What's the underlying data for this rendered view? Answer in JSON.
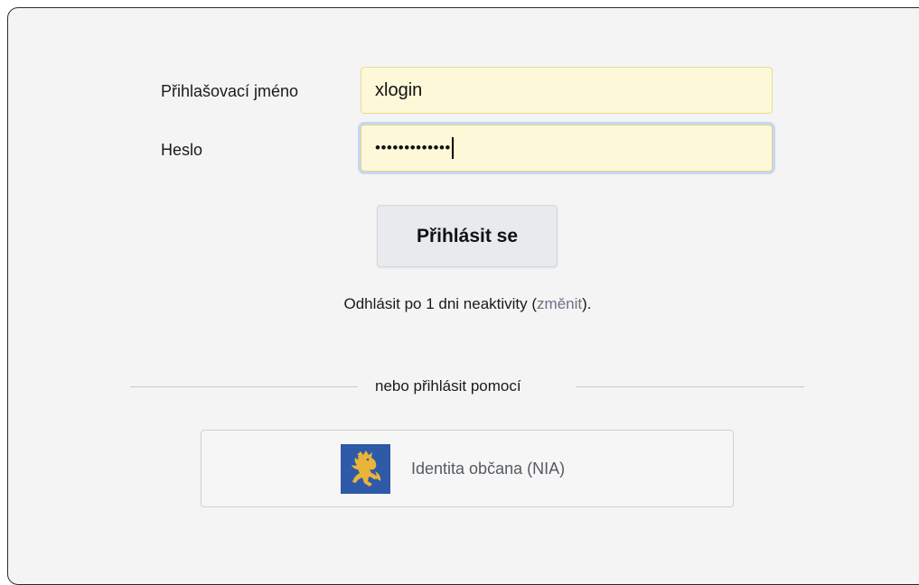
{
  "login_form": {
    "username_label": "Přihlašovací jméno",
    "username_value": "xlogin",
    "password_label": "Heslo",
    "password_masked": "•••••••••••••",
    "submit_label": "Přihlásit se"
  },
  "session_note": {
    "prefix": "Odhlásit po 1 dni neaktivity (",
    "link": "změnit",
    "suffix": ")."
  },
  "alt_login": {
    "divider_text": "nebo přihlásit pomocí",
    "nia_label": "Identita občana (NIA)",
    "nia_icon": "czech-lion-icon"
  },
  "colors": {
    "input_bg": "#fdf8d8",
    "focus_ring": "#c6d8f3",
    "nia_logo_bg": "#2e5aa8",
    "lion": "#e8b53a"
  }
}
